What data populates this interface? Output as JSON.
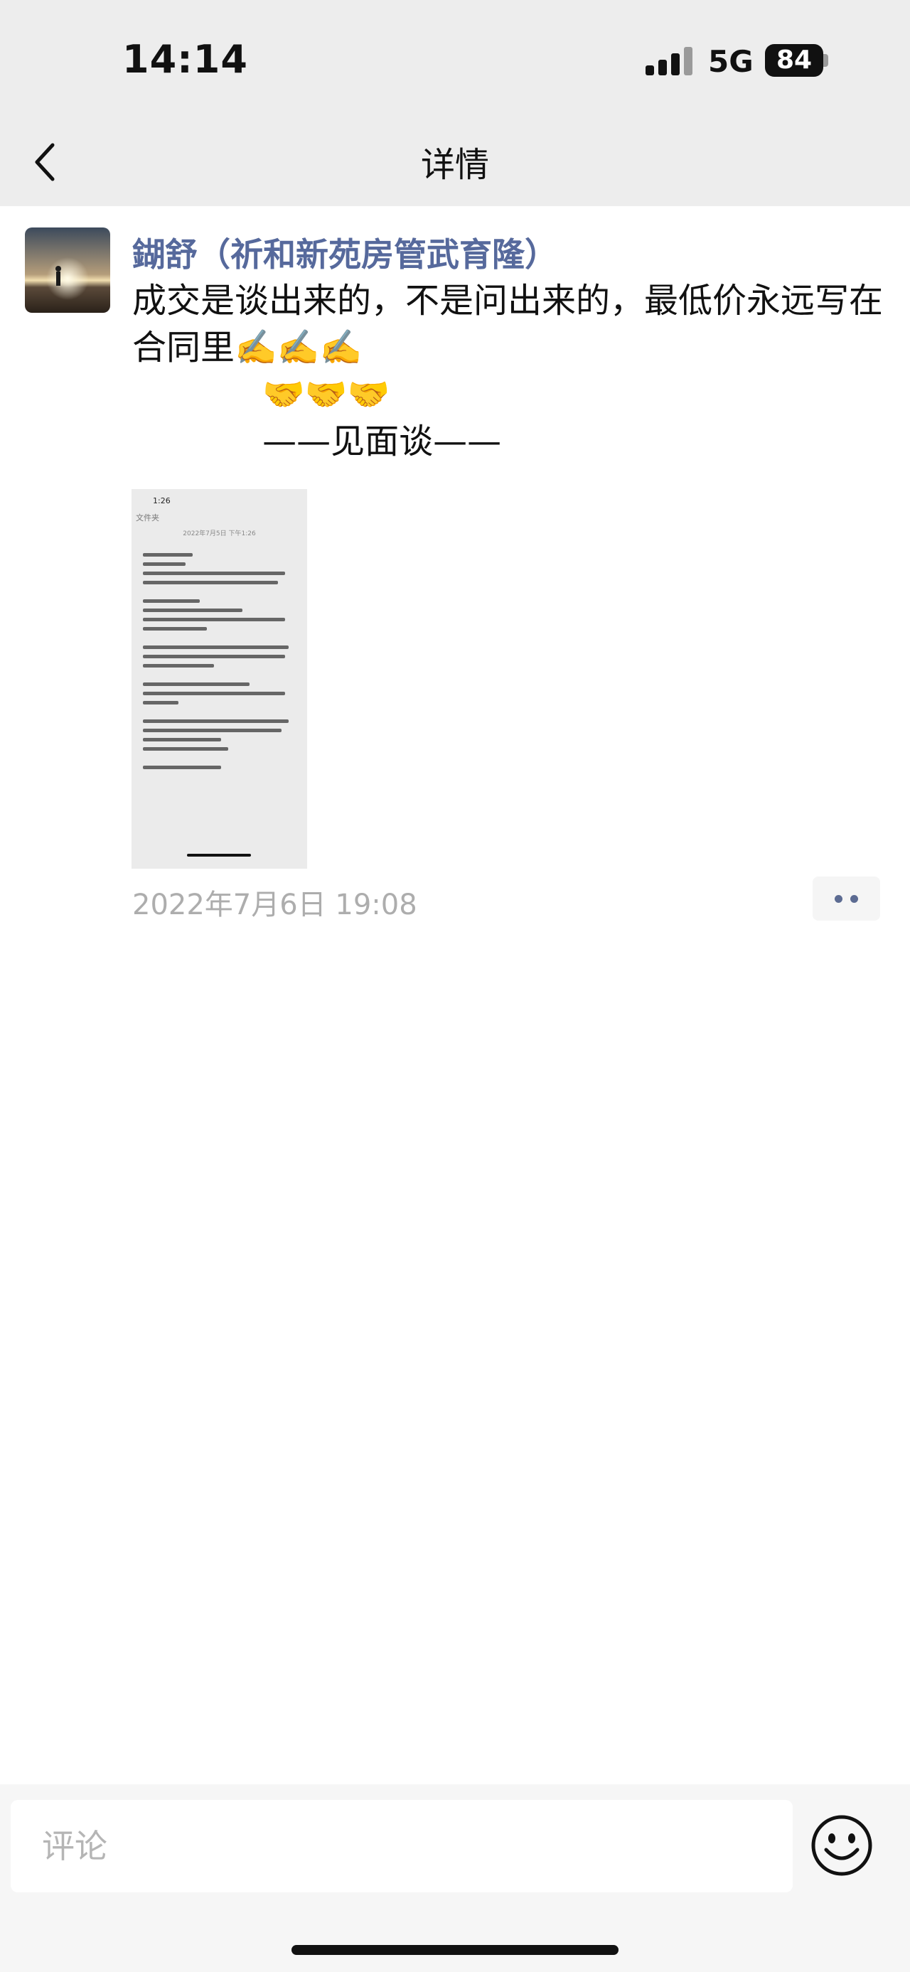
{
  "status_bar": {
    "time": "14:14",
    "network": "5G",
    "battery": "84"
  },
  "header": {
    "title": "详情",
    "back_icon": "chevron-left-icon"
  },
  "post": {
    "author": "鍸舒（祈和新苑房管武育隆）",
    "content": "成交是谈出来的，不是问出来的，最低价永远写在合同里✍️✍️✍️\n            🤝🤝🤝\n            ——见面谈——",
    "timestamp": "2022年7月6日 19:08",
    "more_icon": "ellipsis-icon",
    "image_thumbnail": {
      "status_time": "1:26",
      "back_label": "文件夹",
      "date_line": "2022年7月5日 下午1:26"
    }
  },
  "footer": {
    "comment_placeholder": "评论",
    "emoji_icon": "smiley-face-icon"
  },
  "colors": {
    "author_name": "#56699c",
    "topbar_bg": "#ededed",
    "timestamp": "#adadad"
  }
}
